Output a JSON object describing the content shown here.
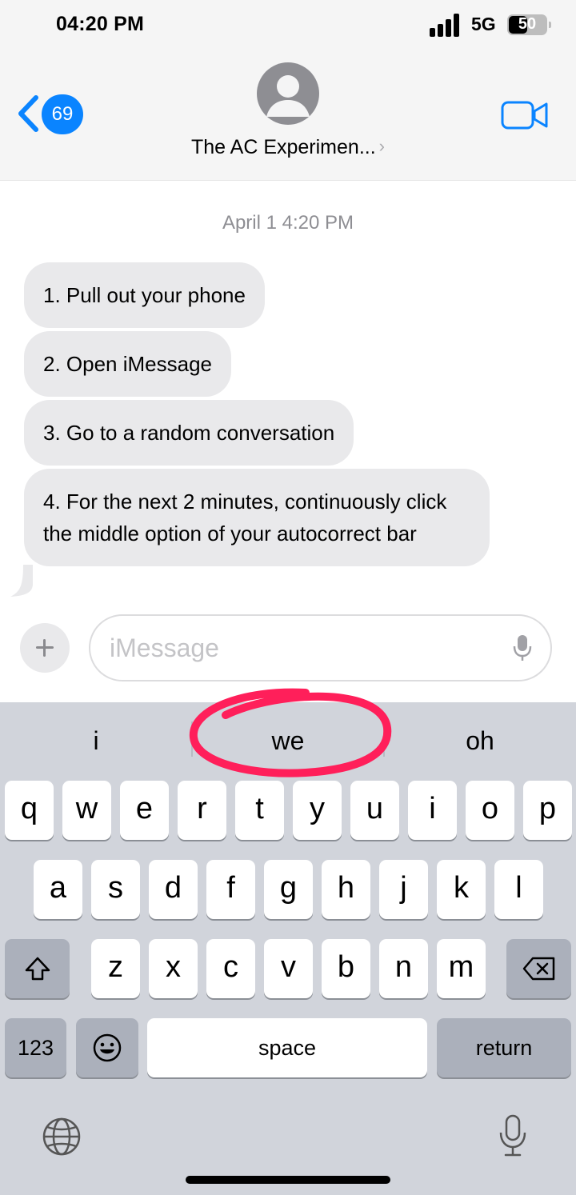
{
  "status_bar": {
    "time": "04:20 PM",
    "network": "5G",
    "battery": "50",
    "battery_level": 0.5
  },
  "header": {
    "back_badge": "69",
    "contact_name": "The AC Experimen...",
    "icons": [
      "chevron-left-icon",
      "person-icon",
      "chevron-right-icon",
      "video-camera-icon"
    ],
    "accent_color": "#0a84ff"
  },
  "conversation": {
    "timestamp": "April 1 4:20 PM",
    "messages": [
      {
        "text": "1. Pull out your phone"
      },
      {
        "text": "2. Open iMessage"
      },
      {
        "text": "3. Go to a random conversation"
      },
      {
        "text": "4. For the next 2 minutes, continuously click the middle option of your autocorrect bar"
      }
    ],
    "bubble_color": "#e9e9eb"
  },
  "composer": {
    "placeholder": "iMessage",
    "icons": [
      "plus-icon",
      "microphone-icon"
    ]
  },
  "keyboard": {
    "suggestions": [
      "i",
      "we",
      "oh"
    ],
    "highlight_color": "#ff1f5a",
    "row1": [
      "q",
      "w",
      "e",
      "r",
      "t",
      "y",
      "u",
      "i",
      "o",
      "p"
    ],
    "row2": [
      "a",
      "s",
      "d",
      "f",
      "g",
      "h",
      "j",
      "k",
      "l"
    ],
    "row3": [
      "z",
      "x",
      "c",
      "v",
      "b",
      "n",
      "m"
    ],
    "numbers_label": "123",
    "space_label": "space",
    "return_label": "return",
    "icons": [
      "shift-icon",
      "delete-icon",
      "emoji-icon",
      "globe-icon",
      "microphone-icon"
    ]
  }
}
